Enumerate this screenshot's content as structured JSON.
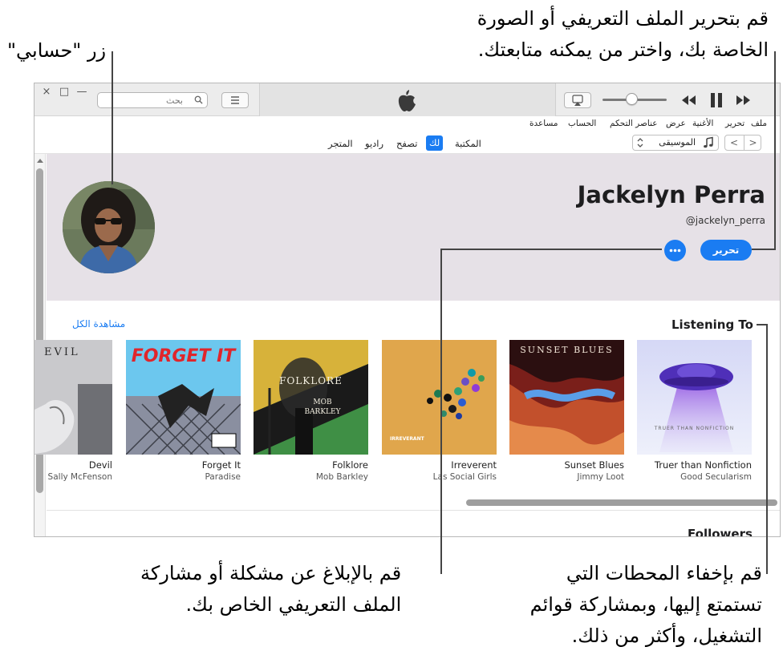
{
  "callouts": {
    "profile_edit": [
      "قم بتحرير الملف التعريفي أو الصورة",
      "الخاصة بك، واختر من يمكنه متابعتك."
    ],
    "account_button": "زر \"حسابي\"",
    "report_share": [
      "قم بالإبلاغ عن مشكلة أو مشاركة",
      "الملف التعريفي الخاص بك."
    ],
    "hide_stations": [
      "قم بإخفاء المحطات التي",
      "تستمتع إليها، وبمشاركة قوائم",
      "التشغيل، وأكثر من ذلك."
    ]
  },
  "titlebar": {
    "search_placeholder": "بحث",
    "window_close": "×",
    "window_maximize": "□",
    "window_minimize": "—"
  },
  "menubar": {
    "items": [
      "ملف",
      "تحرير",
      "الأغنية",
      "عرض",
      "عناصر التحكم",
      "الحساب",
      "مساعدة"
    ]
  },
  "navbar": {
    "back": "<",
    "forward": ">",
    "media_type": "الموسيقى",
    "tabs": [
      {
        "label": "المكتبة",
        "active": false
      },
      {
        "label": "لك",
        "active": true
      },
      {
        "label": "تصفح",
        "active": false
      },
      {
        "label": "راديو",
        "active": false
      },
      {
        "label": "المتجر",
        "active": false
      }
    ]
  },
  "profile": {
    "name": "Jackelyn Perra",
    "handle": "@jackelyn_perra",
    "edit_label": "تحرير",
    "more_label": "•••"
  },
  "listening_to": {
    "title": "Listening To",
    "see_all": "مشاهدة الكل",
    "albums": [
      {
        "title": "Truer than Nonfiction",
        "artist": "Good Secularism",
        "art_text": "TRUER THAN NONFICTION"
      },
      {
        "title": "Sunset Blues",
        "artist": "Jimmy Loot",
        "art_text": "SUNSET BLUES"
      },
      {
        "title": "Irreverent",
        "artist": "Las Social Girls",
        "art_text": "IRREVERANT"
      },
      {
        "title": "Folklore",
        "artist": "Mob Barkley",
        "art_text": "FOLKLORE",
        "art_subtext": "MOB BARKLEY"
      },
      {
        "title": "Forget It",
        "artist": "Paradise",
        "art_text": "FORGET IT"
      },
      {
        "title": "Devil",
        "artist": "Sally McFenson",
        "art_text": "EVIL"
      }
    ]
  },
  "followers": {
    "title": "Followers"
  },
  "colors": {
    "accent": "#1a7cf2",
    "header_bg": "#e6e1e7"
  }
}
